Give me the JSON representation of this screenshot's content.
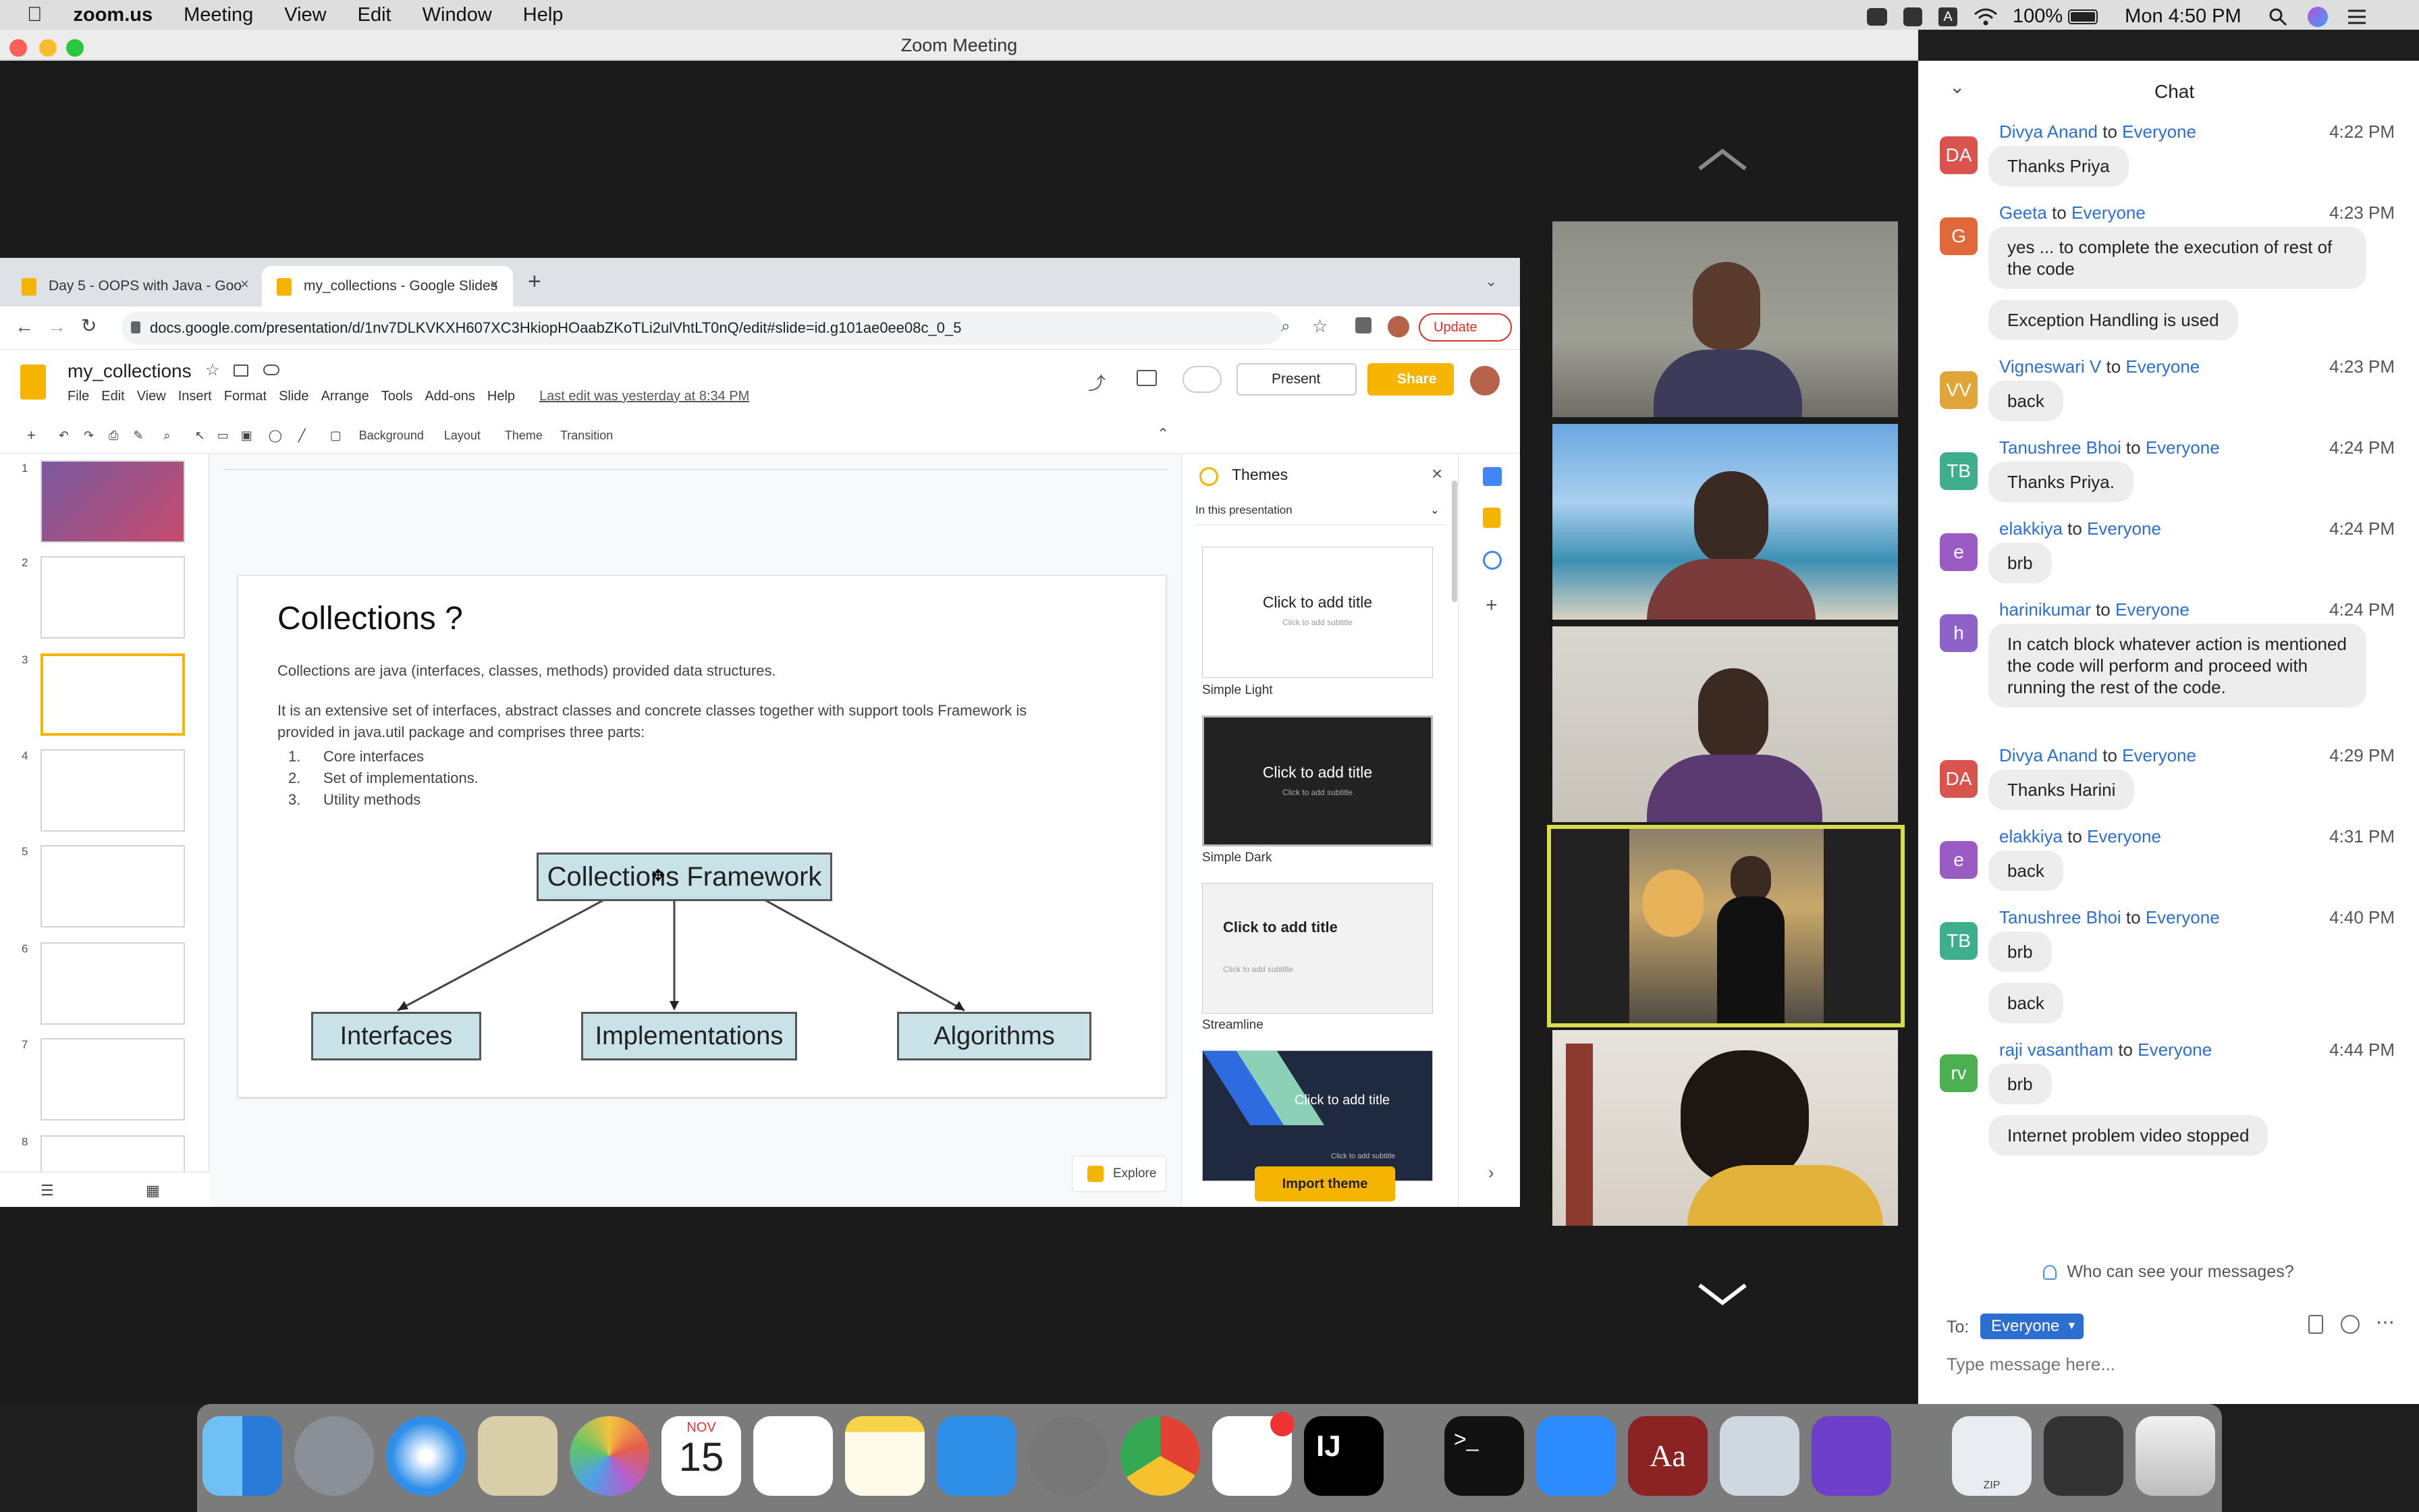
{
  "menubar": {
    "app": "zoom.us",
    "items": [
      "Meeting",
      "View",
      "Edit",
      "Window",
      "Help"
    ],
    "battery": "100%",
    "clock": "Mon 4:50 PM"
  },
  "zoom_title": "Zoom Meeting",
  "browser": {
    "tabs": [
      "Day 5 - OOPS with Java - Goo",
      "my_collections - Google Slides"
    ],
    "url": "docs.google.com/presentation/d/1nv7DLKVKXH607XC3HkiopHOaabZKoTLi2ulVhtLT0nQ/edit#slide=id.g101ae0ee08c_0_5",
    "update_label": "Update"
  },
  "slides_app": {
    "doc_title": "my_collections",
    "menu": [
      "File",
      "Edit",
      "View",
      "Insert",
      "Format",
      "Slide",
      "Arrange",
      "Tools",
      "Add-ons",
      "Help"
    ],
    "last_edit": "Last edit was yesterday at 8:34 PM",
    "present_label": "Present",
    "share_label": "Share",
    "toolbar": {
      "background": "Background",
      "layout": "Layout",
      "theme": "Theme",
      "transition": "Transition"
    },
    "explore_label": "Explore"
  },
  "slide": {
    "title": "Collections ?",
    "para1": "Collections are java (interfaces, classes, methods) provided data structures.",
    "para2": "It is an extensive set of interfaces, abstract classes and concrete classes together with support tools Framework is provided in java.util package and comprises three parts:",
    "list": [
      "Core interfaces",
      "Set of implementations.",
      "Utility methods"
    ],
    "diagram": {
      "root": "Collections Framework",
      "children": [
        "Interfaces",
        "Implementations",
        "Algorithms"
      ]
    }
  },
  "themes_panel": {
    "title": "Themes",
    "dropdown": "In this presentation",
    "themes": [
      {
        "name": "Simple Light",
        "title": "Click to add title",
        "subtitle": "Click to add subtitle"
      },
      {
        "name": "Simple Dark",
        "title": "Click to add title",
        "subtitle": "Click to add subtitle"
      },
      {
        "name": "Streamline",
        "title": "Click to add title",
        "subtitle": "Click to add subtitle"
      },
      {
        "name": "",
        "title": "Click to add title",
        "subtitle": "Click to add subtitle"
      }
    ],
    "import_label": "Import theme"
  },
  "chat": {
    "title": "Chat",
    "messages": [
      {
        "from": "Divya Anand",
        "to": "Everyone",
        "time": "4:22 PM",
        "initials": "DA",
        "color": "#d9534f",
        "texts": [
          "Thanks Priya"
        ]
      },
      {
        "from": "Geeta",
        "to": "Everyone",
        "time": "4:23 PM",
        "initials": "G",
        "color": "#e0693a",
        "texts": [
          "yes ... to complete the execution of rest of the code",
          "Exception Handling is used"
        ]
      },
      {
        "from": "Vigneswari V",
        "to": "Everyone",
        "time": "4:23 PM",
        "initials": "VV",
        "color": "#e0a63a",
        "texts": [
          "back"
        ]
      },
      {
        "from": "Tanushree Bhoi",
        "to": "Everyone",
        "time": "4:24 PM",
        "initials": "TB",
        "color": "#3fae8c",
        "texts": [
          "Thanks Priya."
        ]
      },
      {
        "from": "elakkiya",
        "to": "Everyone",
        "time": "4:24 PM",
        "initials": "e",
        "color": "#9b5bc4",
        "texts": [
          "brb"
        ]
      },
      {
        "from": "harinikumar",
        "to": "Everyone",
        "time": "4:24 PM",
        "initials": "h",
        "color": "#8e63c9",
        "texts": [
          "In catch block whatever action is mentioned the code will perform and proceed with running the rest of the code."
        ]
      },
      {
        "from": "Divya Anand",
        "to": "Everyone",
        "time": "4:29 PM",
        "initials": "DA",
        "color": "#d9534f",
        "texts": [
          "Thanks Harini"
        ]
      },
      {
        "from": "elakkiya",
        "to": "Everyone",
        "time": "4:31 PM",
        "initials": "e",
        "color": "#9b5bc4",
        "texts": [
          "back"
        ]
      },
      {
        "from": "Tanushree Bhoi",
        "to": "Everyone",
        "time": "4:40 PM",
        "initials": "TB",
        "color": "#3fae8c",
        "texts": [
          "brb",
          "back"
        ]
      },
      {
        "from": "raji vasantham",
        "to": "Everyone",
        "time": "4:44 PM",
        "initials": "rv",
        "color": "#4caf50",
        "texts": [
          "brb",
          "Internet problem video stopped"
        ]
      }
    ],
    "to_word": "to",
    "who_can_see": "Who can see your messages?",
    "to_label": "To:",
    "recipient": "Everyone",
    "input_placeholder": "Type message here..."
  },
  "dock": {
    "calendar_month": "NOV",
    "calendar_day": "15",
    "zip_label": "ZIP"
  }
}
